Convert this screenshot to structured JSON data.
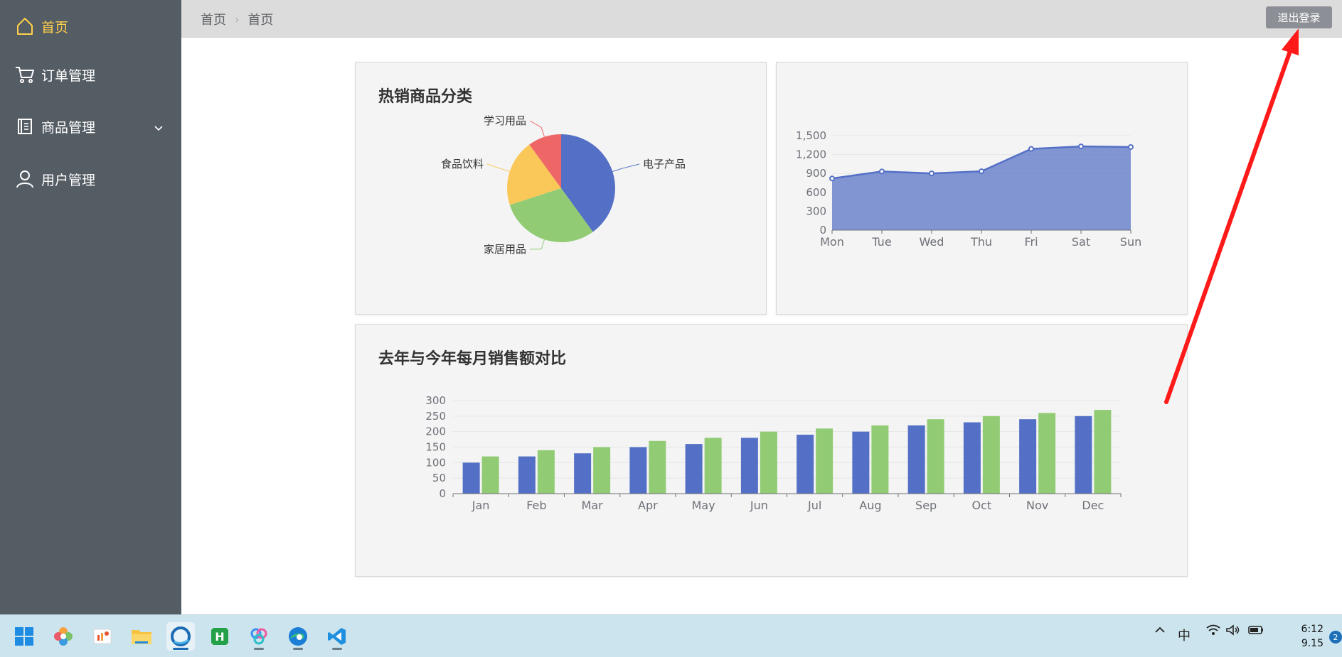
{
  "sidebar": {
    "items": [
      {
        "label": "首页",
        "icon": "home-icon",
        "active": true
      },
      {
        "label": "订单管理",
        "icon": "cart-icon"
      },
      {
        "label": "商品管理",
        "icon": "notebook-icon",
        "has_submenu": true
      },
      {
        "label": "用户管理",
        "icon": "user-icon"
      }
    ]
  },
  "header": {
    "breadcrumb": [
      "首页",
      "首页"
    ],
    "logout_label": "退出登录"
  },
  "cards": {
    "pie_title": "热销商品分类",
    "bar_title": "去年与今年每月销售额对比"
  },
  "colors": {
    "sidebar_bg": "#545c64",
    "active_text": "#ffd04b",
    "blue": "#5470c6",
    "green": "#91cc75",
    "yellow": "#fac858",
    "red": "#ee6666",
    "annotation_arrow": "#ff1a1a"
  },
  "chart_data": [
    {
      "type": "pie",
      "title": "热销商品分类",
      "slices": [
        {
          "name": "电子产品",
          "value": 40,
          "color": "#5470c6"
        },
        {
          "name": "家居用品",
          "value": 30,
          "color": "#91cc75"
        },
        {
          "name": "食品饮料",
          "value": 20,
          "color": "#fac858"
        },
        {
          "name": "学习用品",
          "value": 10,
          "color": "#ee6666"
        }
      ]
    },
    {
      "type": "area",
      "categories": [
        "Mon",
        "Tue",
        "Wed",
        "Thu",
        "Fri",
        "Sat",
        "Sun"
      ],
      "values": [
        820,
        932,
        901,
        934,
        1290,
        1330,
        1320
      ],
      "yticks": [
        "0",
        "300",
        "600",
        "900",
        "1,200",
        "1,500"
      ],
      "ylim": [
        0,
        1500
      ],
      "color": "#5470c6"
    },
    {
      "type": "bar",
      "title": "去年与今年每月销售额对比",
      "categories": [
        "Jan",
        "Feb",
        "Mar",
        "Apr",
        "May",
        "Jun",
        "Jul",
        "Aug",
        "Sep",
        "Oct",
        "Nov",
        "Dec"
      ],
      "series": [
        {
          "values": [
            100,
            120,
            130,
            150,
            160,
            180,
            190,
            200,
            220,
            230,
            240,
            250
          ],
          "color": "#5470c6"
        },
        {
          "values": [
            120,
            140,
            150,
            170,
            180,
            200,
            210,
            220,
            240,
            250,
            260,
            270
          ],
          "color": "#91cc75"
        }
      ],
      "yticks": [
        "0",
        "50",
        "100",
        "150",
        "200",
        "250",
        "300"
      ],
      "ylim": [
        0,
        300
      ]
    }
  ],
  "taskbar": {
    "apps": [
      "windows-start-icon",
      "photos-icon",
      "presentation-icon",
      "file-explorer-icon",
      "browser-app-icon",
      "hbuilder-icon",
      "baidu-netdisk-icon",
      "edge-icon",
      "vscode-icon"
    ],
    "ime_label": "中",
    "time": "6:12",
    "date": "9.15",
    "notification_count": "2"
  }
}
